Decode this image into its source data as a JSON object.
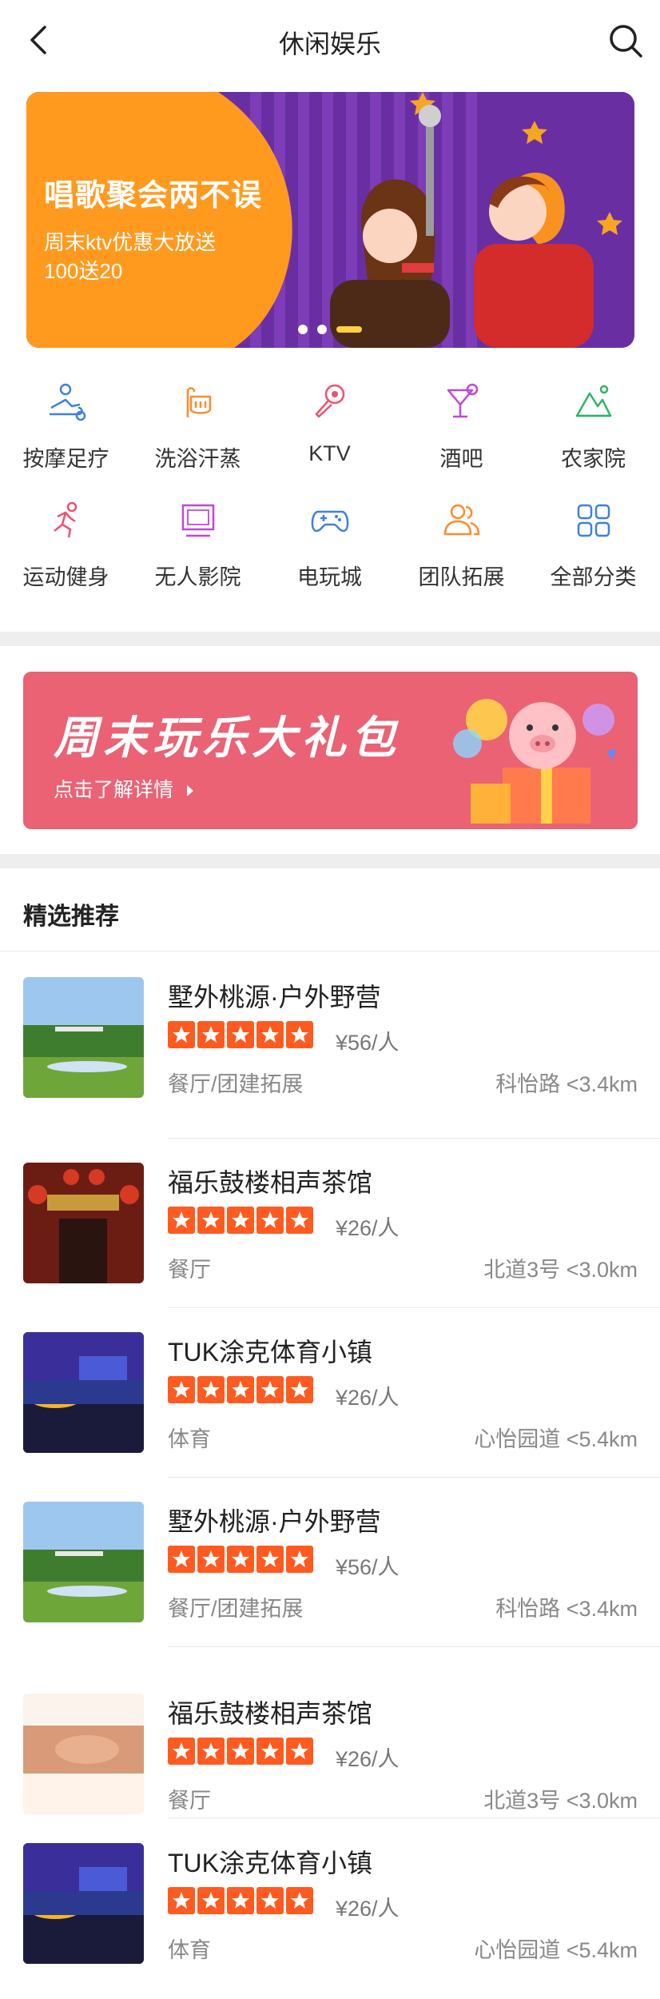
{
  "header": {
    "title": "休闲娱乐"
  },
  "banner": {
    "title": "唱歌聚会两不误",
    "line1": "周末ktv优惠大放送",
    "line2": "100送20",
    "colors": {
      "orange": "#ff9a1f",
      "purple": "#6d33a7"
    }
  },
  "categories": [
    {
      "label": "按摩足疗",
      "icon": "massage-icon"
    },
    {
      "label": "洗浴汗蒸",
      "icon": "shower-icon"
    },
    {
      "label": "KTV",
      "icon": "microphone-icon"
    },
    {
      "label": "酒吧",
      "icon": "cocktail-icon"
    },
    {
      "label": "农家院",
      "icon": "mountain-icon"
    },
    {
      "label": "运动健身",
      "icon": "running-icon"
    },
    {
      "label": "无人影院",
      "icon": "cinema-icon"
    },
    {
      "label": "电玩城",
      "icon": "gamepad-icon"
    },
    {
      "label": "团队拓展",
      "icon": "team-icon"
    },
    {
      "label": "全部分类",
      "icon": "grid-icon"
    }
  ],
  "promo": {
    "title": "周末玩乐大礼包",
    "link": "点击了解详情"
  },
  "section": {
    "title": "精选推荐"
  },
  "items": [
    {
      "name": "墅外桃源·户外野营",
      "rating": 5,
      "price": "¥56/人",
      "tag": "餐厅/团建拓展",
      "distance": "科怡路 <3.4km",
      "thumb": "park"
    },
    {
      "name": "福乐鼓楼相声茶馆",
      "rating": 5,
      "price": "¥26/人",
      "tag": "餐厅",
      "distance": "北道3号 <3.0km",
      "thumb": "teahouse"
    },
    {
      "name": "TUK涂克体育小镇",
      "rating": 5,
      "price": "¥26/人",
      "tag": "体育",
      "distance": "心怡园道 <5.4km",
      "thumb": "sports"
    },
    {
      "name": "墅外桃源·户外野营",
      "rating": 5,
      "price": "¥56/人",
      "tag": "餐厅/团建拓展",
      "distance": "科怡路 <3.4km",
      "thumb": "park"
    },
    {
      "name": "福乐鼓楼相声茶馆",
      "rating": 5,
      "price": "¥26/人",
      "tag": "餐厅",
      "distance": "北道3号 <3.0km",
      "thumb": "massage"
    },
    {
      "name": "TUK涂克体育小镇",
      "rating": 5,
      "price": "¥26/人",
      "tag": "体育",
      "distance": "心怡园道 <5.4km",
      "thumb": "sports"
    }
  ],
  "star_color": "#ff5a1f"
}
